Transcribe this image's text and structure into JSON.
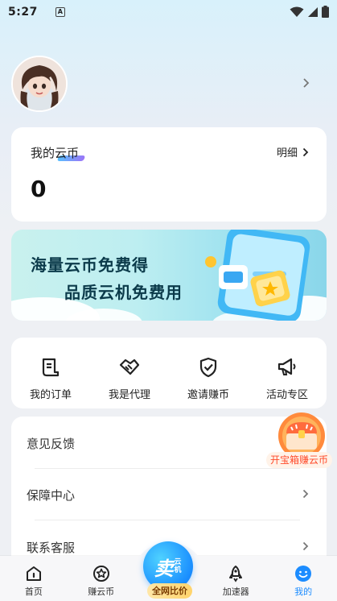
{
  "status_bar": {
    "time": "5:27",
    "notification": "A"
  },
  "coin": {
    "title": "我的云币",
    "detail_label": "明细",
    "value": "0"
  },
  "banner": {
    "line1": "海量云币免费得",
    "line2": "品质云机免费用"
  },
  "quick_actions": [
    {
      "label": "我的订单",
      "icon": "order-icon"
    },
    {
      "label": "我是代理",
      "icon": "handshake-icon"
    },
    {
      "label": "邀请赚币",
      "icon": "shield-check-icon"
    },
    {
      "label": "活动专区",
      "icon": "megaphone-icon"
    }
  ],
  "menu": [
    {
      "label": "意见反馈"
    },
    {
      "label": "保障中心"
    },
    {
      "label": "联系客服"
    }
  ],
  "floating": {
    "label": "开宝箱赚云币"
  },
  "bottom_nav": {
    "items": [
      {
        "label": "首页",
        "icon": "home-icon"
      },
      {
        "label": "赚云币",
        "icon": "coin-badge-icon"
      },
      {
        "label": "加速器",
        "icon": "rocket-icon"
      },
      {
        "label": "我的",
        "icon": "smile-icon"
      }
    ],
    "center_main": "卖",
    "center_sub": "云机",
    "center_tag": "全网比价"
  },
  "colors": {
    "accent": "#1c8cff",
    "floating_text": "#ff4b2b"
  }
}
